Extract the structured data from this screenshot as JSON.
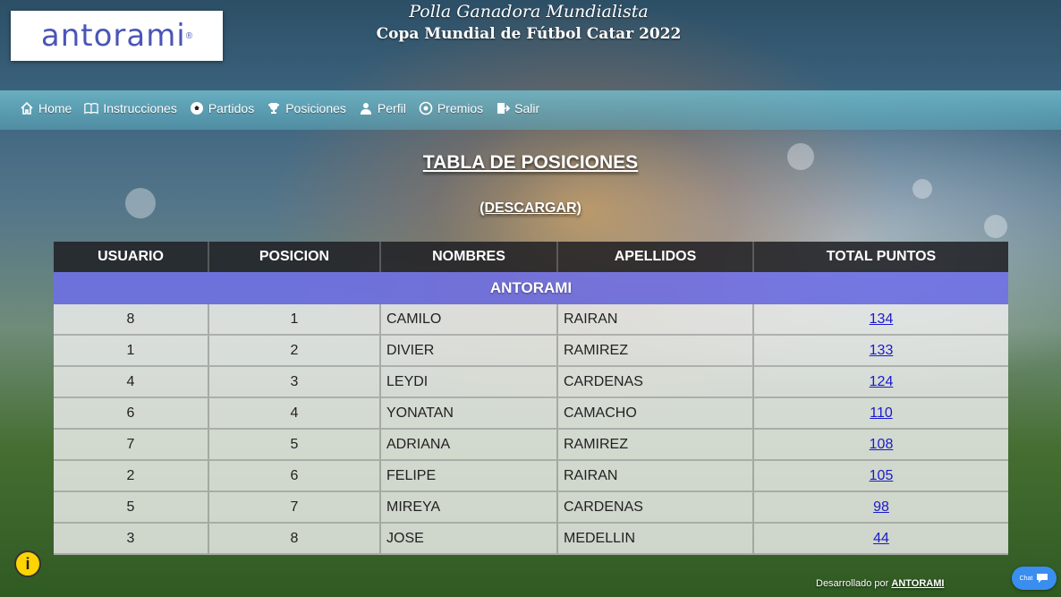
{
  "logo": {
    "text": "antorami",
    "mark": "®"
  },
  "header": {
    "title": "Polla Ganadora Mundialista",
    "subtitle": "Copa Mundial de Fútbol Catar 2022"
  },
  "nav": [
    {
      "label": "Home",
      "icon": "home-icon"
    },
    {
      "label": "Instrucciones",
      "icon": "book-icon"
    },
    {
      "label": "Partidos",
      "icon": "soccer-ball-icon"
    },
    {
      "label": "Posiciones",
      "icon": "trophy-icon"
    },
    {
      "label": "Perfil",
      "icon": "user-icon"
    },
    {
      "label": "Premios",
      "icon": "award-icon"
    },
    {
      "label": "Salir",
      "icon": "exit-icon"
    }
  ],
  "page": {
    "heading": "TABLA DE POSICIONES",
    "download": "(DESCARGAR)"
  },
  "table": {
    "columns": [
      "USUARIO",
      "POSICION",
      "NOMBRES",
      "APELLIDOS",
      "TOTAL PUNTOS"
    ],
    "group": "ANTORAMI",
    "rows": [
      {
        "usuario": "8",
        "posicion": "1",
        "nombre": "CAMILO",
        "apellido": "RAIRAN",
        "puntos": "134"
      },
      {
        "usuario": "1",
        "posicion": "2",
        "nombre": "DIVIER",
        "apellido": "RAMIREZ",
        "puntos": "133"
      },
      {
        "usuario": "4",
        "posicion": "3",
        "nombre": "LEYDI",
        "apellido": "CARDENAS",
        "puntos": "124"
      },
      {
        "usuario": "6",
        "posicion": "4",
        "nombre": "YONATAN",
        "apellido": "CAMACHO",
        "puntos": "110"
      },
      {
        "usuario": "7",
        "posicion": "5",
        "nombre": "ADRIANA",
        "apellido": "RAMIREZ",
        "puntos": "108"
      },
      {
        "usuario": "2",
        "posicion": "6",
        "nombre": "FELIPE",
        "apellido": "RAIRAN",
        "puntos": "105"
      },
      {
        "usuario": "5",
        "posicion": "7",
        "nombre": "MIREYA",
        "apellido": "CARDENAS",
        "puntos": "98"
      },
      {
        "usuario": "3",
        "posicion": "8",
        "nombre": "JOSE",
        "apellido": "MEDELLIN",
        "puntos": "44"
      }
    ]
  },
  "footer": {
    "prefix": "Desarrollado por",
    "brand": "ANTORAMI"
  },
  "info_button": {
    "label": "i"
  },
  "chat": {
    "label": "Chat"
  },
  "colors": {
    "group_row": "#6e6eeb",
    "nav_bar": "#78c8d7",
    "link": "#1a1acc",
    "info": "#ffd400",
    "chat": "#3a8ef0"
  }
}
